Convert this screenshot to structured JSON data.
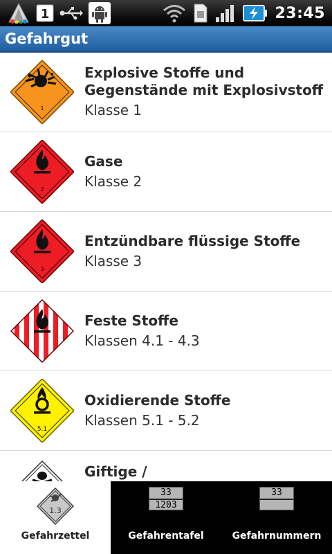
{
  "status_bar": {
    "time": "23:45",
    "notification_count": "1",
    "icons": [
      "app-launcher-icon",
      "notification-count-icon",
      "usb-icon",
      "android-debug-icon",
      "wifi-icon",
      "sim-icon",
      "signal-icon",
      "battery-charging-icon"
    ]
  },
  "app": {
    "title": "Gefahrgut"
  },
  "list": {
    "items": [
      {
        "title": "Explosive Stoffe und Gegenstände mit Explosivstoff",
        "subtitle": "Klasse 1",
        "icon": "explosive-diamond-icon",
        "color": "#f7941d",
        "number": "1"
      },
      {
        "title": "Gase",
        "subtitle": "Klasse 2",
        "icon": "flame-diamond-icon",
        "color": "#ee1c24",
        "number": "2"
      },
      {
        "title": "Entzündbare flüssige Stoffe",
        "subtitle": "Klasse 3",
        "icon": "flame-diamond-icon",
        "color": "#ee1c24",
        "number": "3"
      },
      {
        "title": "Feste Stoffe",
        "subtitle": "Klassen 4.1 - 4.3",
        "icon": "striped-flame-diamond-icon",
        "color": "#ee1c24",
        "number": ""
      },
      {
        "title": "Oxidierende Stoffe",
        "subtitle": "Klassen 5.1 - 5.2",
        "icon": "oxidizer-diamond-icon",
        "color": "#fff200",
        "number": "5.1"
      },
      {
        "title": "Giftige / Ansteckungsgefährliche",
        "subtitle": "",
        "icon": "skull-diamond-icon",
        "color": "#ffffff",
        "number": ""
      }
    ]
  },
  "tabs": [
    {
      "label": "Gefahrzettel",
      "icon": "label-diamond-icon",
      "number": "1.3",
      "active": true
    },
    {
      "label": "Gefahrentafel",
      "icon": "orange-plate-icon",
      "top": "33",
      "bottom": "1203",
      "active": false
    },
    {
      "label": "Gefahrnummern",
      "icon": "number-plate-icon",
      "top": "33",
      "bottom": "",
      "active": false
    }
  ],
  "colors": {
    "titlebar": "#2f74b9",
    "accent_orange": "#f7941d",
    "accent_red": "#ee1c24",
    "accent_yellow": "#fff200"
  }
}
